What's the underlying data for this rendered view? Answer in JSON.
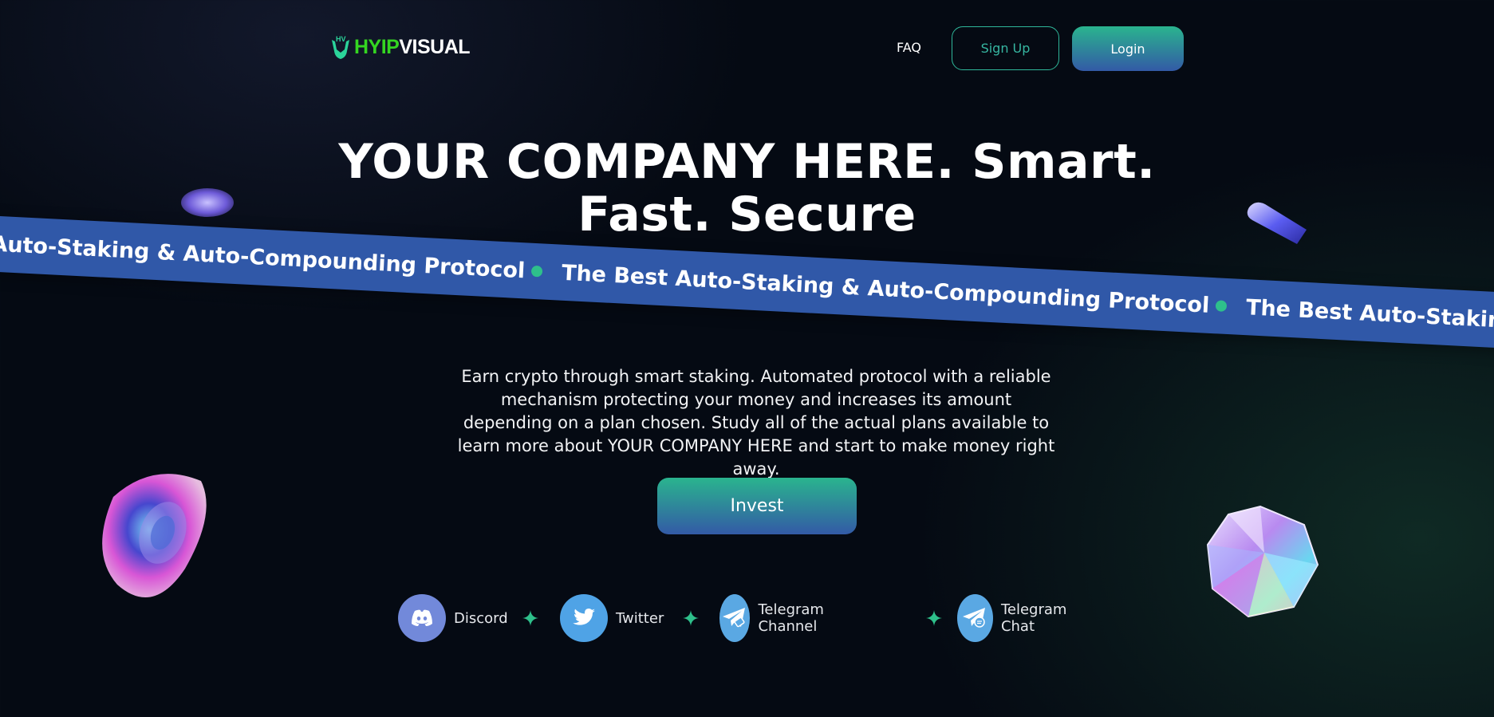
{
  "brand": {
    "logo_part1": "HYIP",
    "logo_part2": "VISUAL"
  },
  "nav": {
    "faq": "FAQ",
    "signup": "Sign Up",
    "login": "Login"
  },
  "hero": {
    "title_line1": "YOUR COMPANY HERE. Smart.",
    "title_line2": "Fast. Secure",
    "ribbon_items": [
      "The Best Auto-Staking & Auto-Compounding Protocol",
      "The Best Auto-Staking & Auto-Compounding Protocol",
      "The Best Auto-Staking & Auto-Compounding Protocol"
    ],
    "description": "Earn crypto through smart staking. Automated protocol with a reliable mechanism protecting your money and increases its amount depending on a plan chosen. Study all of the actual plans available to learn more about YOUR COMPANY HERE and start to make money right away.",
    "invest_label": "Invest"
  },
  "socials": [
    {
      "label": "Discord",
      "icon": "discord-icon",
      "color": "#7289da"
    },
    {
      "label": "Twitter",
      "icon": "twitter-icon",
      "color": "#4fa3e6"
    },
    {
      "label": "Telegram Channel",
      "icon": "telegram-channel-icon",
      "color": "#5aa8e3"
    },
    {
      "label": "Telegram Chat",
      "icon": "telegram-chat-icon",
      "color": "#5aa8e3"
    }
  ],
  "colors": {
    "accent_green": "#2ab48e",
    "accent_blue": "#335aa6",
    "ribbon": "#3058a8",
    "logo_green": "#34d521",
    "background": "#050a13"
  }
}
